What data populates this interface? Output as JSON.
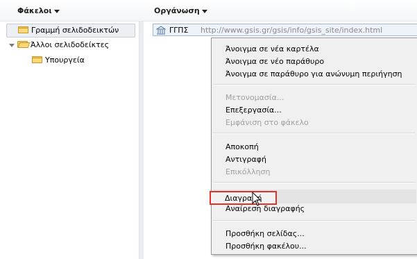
{
  "header": {
    "folders_label": "Φάκελοι",
    "organize_label": "Οργάνωση"
  },
  "tree": {
    "items": [
      {
        "label": "Γραμμή σελιδοδεικτών"
      },
      {
        "label": "Άλλοι σελιδοδείκτες"
      },
      {
        "label": "Υπουργεία"
      }
    ]
  },
  "bookmark": {
    "name": "ΓΓΠΣ",
    "url": "http://www.gsis.gr/gsis/info/gsis_site/index.html"
  },
  "menu": {
    "open_new_tab": "Άνοιγμα σε νέα καρτέλα",
    "open_new_window": "Άνοιγμα σε νέο παράθυρο",
    "open_incognito": "Άνοιγμα σε παράθυρο για ανώνυμη περιήγηση",
    "rename": "Μετονομασία...",
    "edit": "Επεξεργασία...",
    "show_in_folder": "Εμφάνιση στο φάκελο",
    "cut": "Αποκοπή",
    "copy": "Αντιγραφή",
    "paste": "Επικόλληση",
    "delete": "Διαγραφή",
    "undo_delete": "Αναίρεση διαγραφής",
    "add_page": "Προσθήκη σελίδας...",
    "add_folder": "Προσθήκη φακέλου..."
  },
  "colors": {
    "highlight_border": "#e2332b",
    "folder_yellow": "#f5c85a",
    "disabled_text": "#a0a0a0"
  }
}
